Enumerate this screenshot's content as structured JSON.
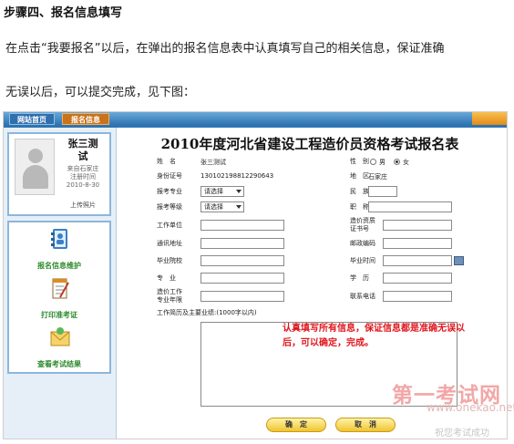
{
  "article": {
    "step_heading": "步骤四、报名信息填写",
    "para1": "在点击“我要报名”以后，在弹出的报名信息表中认真填写自己的相关信息，保证准确",
    "para2": "无误以后，可以提交完成，见下图："
  },
  "app": {
    "tabs": [
      "网站首页",
      "报名信息"
    ],
    "profile": {
      "name_line1": "张三测",
      "name_line2": "试",
      "from": "来自石家庄",
      "reg_label": "注册时间",
      "reg_date": "2010-8-30",
      "upload": "上传照片"
    },
    "menu": [
      "报名信息维护",
      "打印准考证",
      "查看考试结果"
    ],
    "form": {
      "title": "2010年度河北省建设工程造价员资格考试报名表",
      "name_label": "姓　名",
      "name_value": "张三测试",
      "gender_label": "性　别",
      "gender_male": "男",
      "gender_female": "女",
      "gender_selected": "女",
      "id_label": "身份证号",
      "id_value": "130102198812290643",
      "region_label": "地　区",
      "region_value": "石家庄",
      "major_label": "报考专业",
      "major_value": "请选择",
      "ethnicity_label": "民　族",
      "level_label": "报考等级",
      "level_value": "请选择",
      "title_label": "职　称",
      "work_label": "工作单位",
      "cert_label1": "造价资质",
      "cert_label2": "证书号",
      "address_label": "通讯地址",
      "postcode_label": "邮政编码",
      "school_label": "毕业院校",
      "grad_time_label": "毕业时间",
      "specialty_label": "专　业",
      "education_label": "学　历",
      "years_label1": "造价工作",
      "years_label2": "专业年限",
      "phone_label": "联系电话",
      "resume_label": "工作简历及主要业绩:(1000字以内)",
      "note": "认真填写所有信息，保证信息都是准确无误以后，可以确定，完成。",
      "confirm": "确　定",
      "cancel": "取　消"
    }
  },
  "watermark": {
    "line1": "第一考试网",
    "line2": "www.onekao.net",
    "line3": "祝您考试成功"
  },
  "colors": {
    "accent_blue": "#2e74b2",
    "accent_orange": "#e48a18",
    "menu_green": "#2b8a2b",
    "note_red": "#e0161d"
  }
}
